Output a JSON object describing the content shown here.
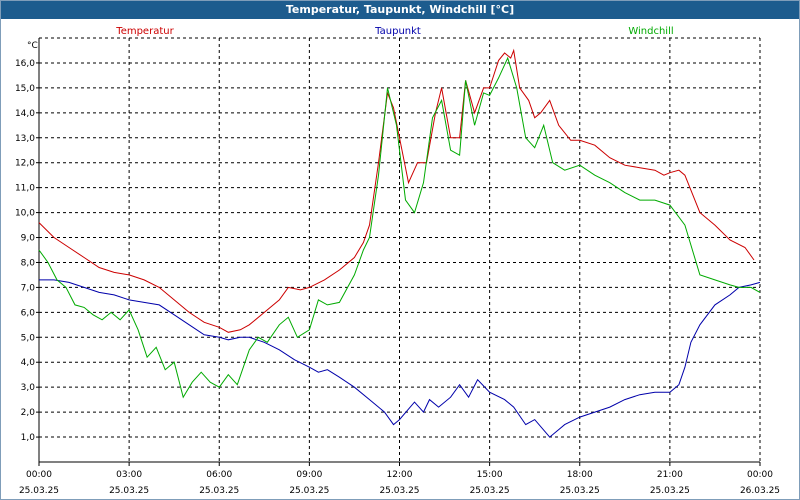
{
  "window": {
    "title": "Temperatur, Taupunkt, Windchill [°C]"
  },
  "chart_data": {
    "type": "line",
    "title": "Temperatur, Taupunkt, Windchill [°C]",
    "ylabel": "°C",
    "xlabel": "",
    "xlim": [
      0,
      24
    ],
    "ylim": [
      0,
      17
    ],
    "grid": true,
    "legend_position": "top",
    "y_ticks": [
      "1,0",
      "2,0",
      "3,0",
      "4,0",
      "5,0",
      "6,0",
      "7,0",
      "8,0",
      "9,0",
      "10,0",
      "11,0",
      "12,0",
      "13,0",
      "14,0",
      "15,0",
      "16,0"
    ],
    "x_ticks": [
      {
        "time": "00:00",
        "date": "25.03.25"
      },
      {
        "time": "03:00",
        "date": "25.03.25"
      },
      {
        "time": "06:00",
        "date": "25.03.25"
      },
      {
        "time": "09:00",
        "date": "25.03.25"
      },
      {
        "time": "12:00",
        "date": "25.03.25"
      },
      {
        "time": "15:00",
        "date": "25.03.25"
      },
      {
        "time": "18:00",
        "date": "25.03.25"
      },
      {
        "time": "21:00",
        "date": "25.03.25"
      },
      {
        "time": "00:00",
        "date": "26.03.25"
      }
    ],
    "series": [
      {
        "name": "Temperatur",
        "color": "#cc0000",
        "points": [
          [
            0,
            9.6
          ],
          [
            0.5,
            9.0
          ],
          [
            1,
            8.6
          ],
          [
            1.5,
            8.2
          ],
          [
            2,
            7.8
          ],
          [
            2.5,
            7.6
          ],
          [
            3,
            7.5
          ],
          [
            3.5,
            7.3
          ],
          [
            4,
            7.0
          ],
          [
            4.5,
            6.5
          ],
          [
            5,
            6.0
          ],
          [
            5.5,
            5.6
          ],
          [
            6,
            5.4
          ],
          [
            6.3,
            5.2
          ],
          [
            6.7,
            5.3
          ],
          [
            7,
            5.5
          ],
          [
            7.5,
            6.0
          ],
          [
            8,
            6.5
          ],
          [
            8.3,
            7.0
          ],
          [
            8.7,
            6.9
          ],
          [
            9,
            7.0
          ],
          [
            9.5,
            7.3
          ],
          [
            10,
            7.7
          ],
          [
            10.5,
            8.2
          ],
          [
            10.8,
            8.8
          ],
          [
            11,
            9.5
          ],
          [
            11.3,
            12.0
          ],
          [
            11.6,
            14.8
          ],
          [
            11.8,
            14.2
          ],
          [
            12,
            13.0
          ],
          [
            12.3,
            11.2
          ],
          [
            12.6,
            12.0
          ],
          [
            12.9,
            12.0
          ],
          [
            13.2,
            14.0
          ],
          [
            13.4,
            15.0
          ],
          [
            13.7,
            13.0
          ],
          [
            14,
            13.0
          ],
          [
            14.2,
            15.3
          ],
          [
            14.5,
            14.0
          ],
          [
            14.8,
            15.0
          ],
          [
            15,
            15.0
          ],
          [
            15.3,
            16.1
          ],
          [
            15.5,
            16.4
          ],
          [
            15.7,
            16.2
          ],
          [
            15.8,
            16.5
          ],
          [
            16,
            15.0
          ],
          [
            16.3,
            14.5
          ],
          [
            16.5,
            13.8
          ],
          [
            16.7,
            14.0
          ],
          [
            17,
            14.5
          ],
          [
            17.3,
            13.5
          ],
          [
            17.7,
            12.9
          ],
          [
            18,
            12.9
          ],
          [
            18.5,
            12.7
          ],
          [
            19,
            12.2
          ],
          [
            19.5,
            11.9
          ],
          [
            20,
            11.8
          ],
          [
            20.5,
            11.7
          ],
          [
            20.8,
            11.5
          ],
          [
            21,
            11.6
          ],
          [
            21.3,
            11.7
          ],
          [
            21.5,
            11.5
          ],
          [
            22,
            10.0
          ],
          [
            22.5,
            9.5
          ],
          [
            23,
            8.9
          ],
          [
            23.5,
            8.6
          ],
          [
            23.8,
            8.1
          ]
        ]
      },
      {
        "name": "Taupunkt",
        "color": "#0000aa",
        "points": [
          [
            0,
            7.3
          ],
          [
            0.5,
            7.3
          ],
          [
            1,
            7.2
          ],
          [
            1.5,
            7.0
          ],
          [
            2,
            6.8
          ],
          [
            2.5,
            6.7
          ],
          [
            3,
            6.5
          ],
          [
            3.5,
            6.4
          ],
          [
            4,
            6.3
          ],
          [
            4.5,
            5.9
          ],
          [
            5,
            5.5
          ],
          [
            5.5,
            5.1
          ],
          [
            6,
            5.0
          ],
          [
            6.3,
            4.9
          ],
          [
            6.7,
            5.0
          ],
          [
            7,
            5.0
          ],
          [
            7.5,
            4.8
          ],
          [
            8,
            4.5
          ],
          [
            8.5,
            4.1
          ],
          [
            9,
            3.8
          ],
          [
            9.3,
            3.6
          ],
          [
            9.6,
            3.7
          ],
          [
            10,
            3.4
          ],
          [
            10.5,
            3.0
          ],
          [
            11,
            2.5
          ],
          [
            11.5,
            2.0
          ],
          [
            11.8,
            1.5
          ],
          [
            12,
            1.7
          ],
          [
            12.5,
            2.4
          ],
          [
            12.8,
            2.0
          ],
          [
            13,
            2.5
          ],
          [
            13.3,
            2.2
          ],
          [
            13.7,
            2.6
          ],
          [
            14,
            3.1
          ],
          [
            14.3,
            2.6
          ],
          [
            14.6,
            3.3
          ],
          [
            15,
            2.8
          ],
          [
            15.5,
            2.5
          ],
          [
            15.8,
            2.2
          ],
          [
            16.2,
            1.5
          ],
          [
            16.5,
            1.7
          ],
          [
            17,
            1.0
          ],
          [
            17.3,
            1.3
          ],
          [
            17.5,
            1.5
          ],
          [
            18,
            1.8
          ],
          [
            18.5,
            2.0
          ],
          [
            19,
            2.2
          ],
          [
            19.5,
            2.5
          ],
          [
            20,
            2.7
          ],
          [
            20.5,
            2.8
          ],
          [
            21,
            2.8
          ],
          [
            21.3,
            3.1
          ],
          [
            21.5,
            3.8
          ],
          [
            21.7,
            4.8
          ],
          [
            22,
            5.5
          ],
          [
            22.5,
            6.3
          ],
          [
            23,
            6.7
          ],
          [
            23.3,
            7.0
          ],
          [
            23.7,
            7.1
          ],
          [
            24,
            7.2
          ]
        ]
      },
      {
        "name": "Windchill",
        "color": "#00aa00",
        "points": [
          [
            0,
            8.5
          ],
          [
            0.3,
            8.0
          ],
          [
            0.6,
            7.3
          ],
          [
            0.9,
            7.0
          ],
          [
            1.2,
            6.3
          ],
          [
            1.5,
            6.2
          ],
          [
            1.8,
            5.9
          ],
          [
            2.1,
            5.7
          ],
          [
            2.4,
            6.0
          ],
          [
            2.7,
            5.7
          ],
          [
            3,
            6.1
          ],
          [
            3.3,
            5.3
          ],
          [
            3.6,
            4.2
          ],
          [
            3.9,
            4.6
          ],
          [
            4.2,
            3.7
          ],
          [
            4.5,
            4.0
          ],
          [
            4.8,
            2.6
          ],
          [
            5.1,
            3.2
          ],
          [
            5.4,
            3.6
          ],
          [
            5.7,
            3.2
          ],
          [
            6,
            3.0
          ],
          [
            6.3,
            3.5
          ],
          [
            6.6,
            3.1
          ],
          [
            7,
            4.5
          ],
          [
            7.3,
            5.0
          ],
          [
            7.6,
            4.8
          ],
          [
            8,
            5.5
          ],
          [
            8.3,
            5.8
          ],
          [
            8.6,
            5.0
          ],
          [
            9,
            5.3
          ],
          [
            9.3,
            6.5
          ],
          [
            9.6,
            6.3
          ],
          [
            10,
            6.4
          ],
          [
            10.5,
            7.5
          ],
          [
            10.8,
            8.5
          ],
          [
            11,
            9.0
          ],
          [
            11.3,
            11.5
          ],
          [
            11.6,
            15.0
          ],
          [
            11.9,
            13.5
          ],
          [
            12.2,
            10.5
          ],
          [
            12.5,
            10.0
          ],
          [
            12.8,
            11.2
          ],
          [
            13.1,
            13.8
          ],
          [
            13.4,
            14.5
          ],
          [
            13.7,
            12.5
          ],
          [
            14,
            12.3
          ],
          [
            14.2,
            15.3
          ],
          [
            14.5,
            13.5
          ],
          [
            14.8,
            14.8
          ],
          [
            15,
            14.7
          ],
          [
            15.3,
            15.4
          ],
          [
            15.6,
            16.2
          ],
          [
            15.9,
            15.0
          ],
          [
            16.2,
            13.0
          ],
          [
            16.5,
            12.6
          ],
          [
            16.8,
            13.5
          ],
          [
            17.1,
            12.0
          ],
          [
            17.5,
            11.7
          ],
          [
            18,
            11.9
          ],
          [
            18.5,
            11.5
          ],
          [
            19,
            11.2
          ],
          [
            19.5,
            10.8
          ],
          [
            20,
            10.5
          ],
          [
            20.5,
            10.5
          ],
          [
            21,
            10.3
          ],
          [
            21.5,
            9.5
          ],
          [
            22,
            7.5
          ],
          [
            22.5,
            7.3
          ],
          [
            23,
            7.1
          ],
          [
            23.3,
            7.0
          ],
          [
            23.7,
            7.0
          ],
          [
            24,
            6.8
          ]
        ]
      }
    ]
  }
}
